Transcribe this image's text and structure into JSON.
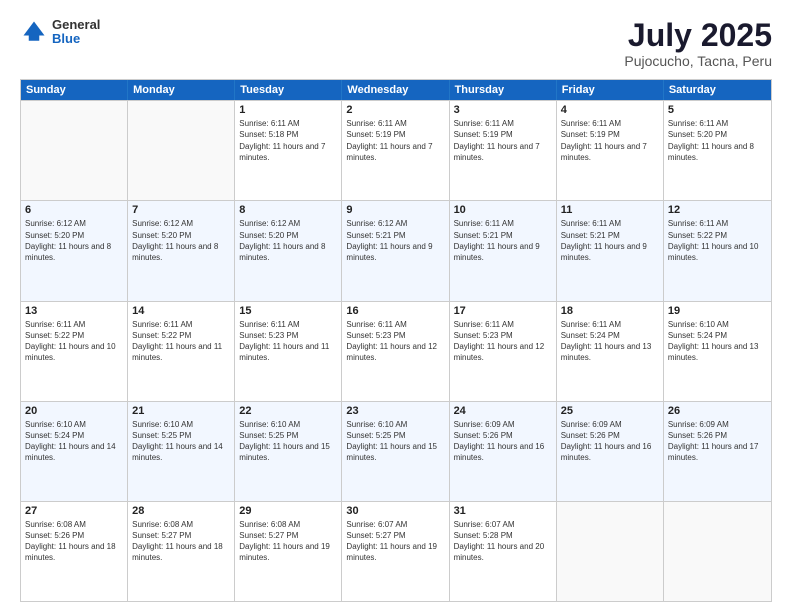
{
  "logo": {
    "general": "General",
    "blue": "Blue"
  },
  "title": "July 2025",
  "subtitle": "Pujocucho, Tacna, Peru",
  "headers": [
    "Sunday",
    "Monday",
    "Tuesday",
    "Wednesday",
    "Thursday",
    "Friday",
    "Saturday"
  ],
  "weeks": [
    [
      {
        "day": "",
        "sunrise": "",
        "sunset": "",
        "daylight": "",
        "empty": true
      },
      {
        "day": "",
        "sunrise": "",
        "sunset": "",
        "daylight": "",
        "empty": true
      },
      {
        "day": "1",
        "sunrise": "Sunrise: 6:11 AM",
        "sunset": "Sunset: 5:18 PM",
        "daylight": "Daylight: 11 hours and 7 minutes.",
        "empty": false
      },
      {
        "day": "2",
        "sunrise": "Sunrise: 6:11 AM",
        "sunset": "Sunset: 5:19 PM",
        "daylight": "Daylight: 11 hours and 7 minutes.",
        "empty": false
      },
      {
        "day": "3",
        "sunrise": "Sunrise: 6:11 AM",
        "sunset": "Sunset: 5:19 PM",
        "daylight": "Daylight: 11 hours and 7 minutes.",
        "empty": false
      },
      {
        "day": "4",
        "sunrise": "Sunrise: 6:11 AM",
        "sunset": "Sunset: 5:19 PM",
        "daylight": "Daylight: 11 hours and 7 minutes.",
        "empty": false
      },
      {
        "day": "5",
        "sunrise": "Sunrise: 6:11 AM",
        "sunset": "Sunset: 5:20 PM",
        "daylight": "Daylight: 11 hours and 8 minutes.",
        "empty": false
      }
    ],
    [
      {
        "day": "6",
        "sunrise": "Sunrise: 6:12 AM",
        "sunset": "Sunset: 5:20 PM",
        "daylight": "Daylight: 11 hours and 8 minutes.",
        "empty": false
      },
      {
        "day": "7",
        "sunrise": "Sunrise: 6:12 AM",
        "sunset": "Sunset: 5:20 PM",
        "daylight": "Daylight: 11 hours and 8 minutes.",
        "empty": false
      },
      {
        "day": "8",
        "sunrise": "Sunrise: 6:12 AM",
        "sunset": "Sunset: 5:20 PM",
        "daylight": "Daylight: 11 hours and 8 minutes.",
        "empty": false
      },
      {
        "day": "9",
        "sunrise": "Sunrise: 6:12 AM",
        "sunset": "Sunset: 5:21 PM",
        "daylight": "Daylight: 11 hours and 9 minutes.",
        "empty": false
      },
      {
        "day": "10",
        "sunrise": "Sunrise: 6:11 AM",
        "sunset": "Sunset: 5:21 PM",
        "daylight": "Daylight: 11 hours and 9 minutes.",
        "empty": false
      },
      {
        "day": "11",
        "sunrise": "Sunrise: 6:11 AM",
        "sunset": "Sunset: 5:21 PM",
        "daylight": "Daylight: 11 hours and 9 minutes.",
        "empty": false
      },
      {
        "day": "12",
        "sunrise": "Sunrise: 6:11 AM",
        "sunset": "Sunset: 5:22 PM",
        "daylight": "Daylight: 11 hours and 10 minutes.",
        "empty": false
      }
    ],
    [
      {
        "day": "13",
        "sunrise": "Sunrise: 6:11 AM",
        "sunset": "Sunset: 5:22 PM",
        "daylight": "Daylight: 11 hours and 10 minutes.",
        "empty": false
      },
      {
        "day": "14",
        "sunrise": "Sunrise: 6:11 AM",
        "sunset": "Sunset: 5:22 PM",
        "daylight": "Daylight: 11 hours and 11 minutes.",
        "empty": false
      },
      {
        "day": "15",
        "sunrise": "Sunrise: 6:11 AM",
        "sunset": "Sunset: 5:23 PM",
        "daylight": "Daylight: 11 hours and 11 minutes.",
        "empty": false
      },
      {
        "day": "16",
        "sunrise": "Sunrise: 6:11 AM",
        "sunset": "Sunset: 5:23 PM",
        "daylight": "Daylight: 11 hours and 12 minutes.",
        "empty": false
      },
      {
        "day": "17",
        "sunrise": "Sunrise: 6:11 AM",
        "sunset": "Sunset: 5:23 PM",
        "daylight": "Daylight: 11 hours and 12 minutes.",
        "empty": false
      },
      {
        "day": "18",
        "sunrise": "Sunrise: 6:11 AM",
        "sunset": "Sunset: 5:24 PM",
        "daylight": "Daylight: 11 hours and 13 minutes.",
        "empty": false
      },
      {
        "day": "19",
        "sunrise": "Sunrise: 6:10 AM",
        "sunset": "Sunset: 5:24 PM",
        "daylight": "Daylight: 11 hours and 13 minutes.",
        "empty": false
      }
    ],
    [
      {
        "day": "20",
        "sunrise": "Sunrise: 6:10 AM",
        "sunset": "Sunset: 5:24 PM",
        "daylight": "Daylight: 11 hours and 14 minutes.",
        "empty": false
      },
      {
        "day": "21",
        "sunrise": "Sunrise: 6:10 AM",
        "sunset": "Sunset: 5:25 PM",
        "daylight": "Daylight: 11 hours and 14 minutes.",
        "empty": false
      },
      {
        "day": "22",
        "sunrise": "Sunrise: 6:10 AM",
        "sunset": "Sunset: 5:25 PM",
        "daylight": "Daylight: 11 hours and 15 minutes.",
        "empty": false
      },
      {
        "day": "23",
        "sunrise": "Sunrise: 6:10 AM",
        "sunset": "Sunset: 5:25 PM",
        "daylight": "Daylight: 11 hours and 15 minutes.",
        "empty": false
      },
      {
        "day": "24",
        "sunrise": "Sunrise: 6:09 AM",
        "sunset": "Sunset: 5:26 PM",
        "daylight": "Daylight: 11 hours and 16 minutes.",
        "empty": false
      },
      {
        "day": "25",
        "sunrise": "Sunrise: 6:09 AM",
        "sunset": "Sunset: 5:26 PM",
        "daylight": "Daylight: 11 hours and 16 minutes.",
        "empty": false
      },
      {
        "day": "26",
        "sunrise": "Sunrise: 6:09 AM",
        "sunset": "Sunset: 5:26 PM",
        "daylight": "Daylight: 11 hours and 17 minutes.",
        "empty": false
      }
    ],
    [
      {
        "day": "27",
        "sunrise": "Sunrise: 6:08 AM",
        "sunset": "Sunset: 5:26 PM",
        "daylight": "Daylight: 11 hours and 18 minutes.",
        "empty": false
      },
      {
        "day": "28",
        "sunrise": "Sunrise: 6:08 AM",
        "sunset": "Sunset: 5:27 PM",
        "daylight": "Daylight: 11 hours and 18 minutes.",
        "empty": false
      },
      {
        "day": "29",
        "sunrise": "Sunrise: 6:08 AM",
        "sunset": "Sunset: 5:27 PM",
        "daylight": "Daylight: 11 hours and 19 minutes.",
        "empty": false
      },
      {
        "day": "30",
        "sunrise": "Sunrise: 6:07 AM",
        "sunset": "Sunset: 5:27 PM",
        "daylight": "Daylight: 11 hours and 19 minutes.",
        "empty": false
      },
      {
        "day": "31",
        "sunrise": "Sunrise: 6:07 AM",
        "sunset": "Sunset: 5:28 PM",
        "daylight": "Daylight: 11 hours and 20 minutes.",
        "empty": false
      },
      {
        "day": "",
        "sunrise": "",
        "sunset": "",
        "daylight": "",
        "empty": true
      },
      {
        "day": "",
        "sunrise": "",
        "sunset": "",
        "daylight": "",
        "empty": true
      }
    ]
  ]
}
